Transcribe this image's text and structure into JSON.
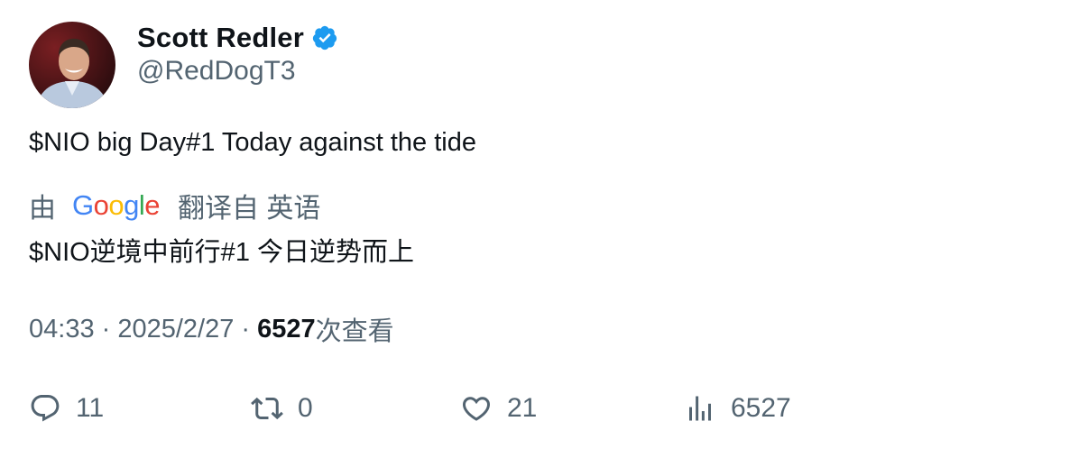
{
  "author": {
    "display_name": "Scott Redler",
    "handle": "@RedDogT3",
    "verified": true,
    "verified_color": "#1d9bf0"
  },
  "tweet": {
    "text": "$NIO big Day#1 Today against the tide"
  },
  "translation": {
    "by_label": "由",
    "provider": [
      "G",
      "o",
      "o",
      "g",
      "l",
      "e"
    ],
    "provider_colors": [
      "#4285f4",
      "#ea4335",
      "#fbbc05",
      "#4285f4",
      "#34a853",
      "#ea4335"
    ],
    "from_label": "翻译自 英语",
    "translated_text": "$NIO逆境中前行#1 今日逆势而上"
  },
  "meta": {
    "time": "04:33",
    "separator": " · ",
    "date": "2025/2/27",
    "views_count": "6527",
    "views_label": "次查看"
  },
  "actions": {
    "reply": {
      "icon": "reply-icon",
      "count": "11"
    },
    "retweet": {
      "icon": "retweet-icon",
      "count": "0"
    },
    "like": {
      "icon": "heart-icon",
      "count": "21"
    },
    "views": {
      "icon": "analytics-icon",
      "count": "6527"
    }
  },
  "colors": {
    "text_primary": "#0f1419",
    "text_secondary": "#536471"
  }
}
